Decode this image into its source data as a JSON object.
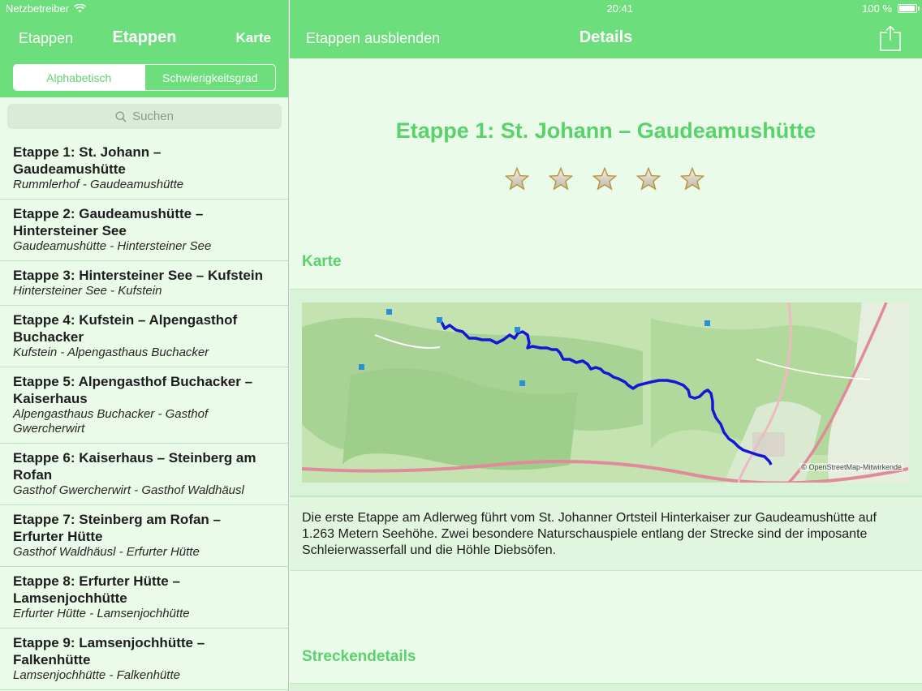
{
  "status_bar": {
    "carrier": "Netzbetreiber",
    "time": "20:41",
    "battery": "100 %"
  },
  "left_nav": {
    "back_label": "Etappen",
    "title": "Etappen",
    "map_label": "Karte"
  },
  "segmented_control": {
    "options": [
      "Alphabetisch",
      "Schwierigkeitsgrad"
    ],
    "selected": "Alphabetisch"
  },
  "search": {
    "placeholder": "Suchen"
  },
  "stages": [
    {
      "title": "Etappe 1: St. Johann – Gaudeamushütte",
      "subtitle": "Rummlerhof - Gaudeamushütte"
    },
    {
      "title": "Etappe 2: Gaudeamushütte – Hintersteiner See",
      "subtitle": "Gaudeamushütte - Hintersteiner See"
    },
    {
      "title": "Etappe 3: Hintersteiner See – Kufstein",
      "subtitle": "Hintersteiner See - Kufstein"
    },
    {
      "title": "Etappe 4: Kufstein –  Alpengasthof Buchacker",
      "subtitle": "Kufstein - Alpengasthaus Buchacker"
    },
    {
      "title": "Etappe 5: Alpengasthof Buchacker – Kaiserhaus",
      "subtitle": "Alpengasthaus Buchacker - Gasthof Gwercherwirt"
    },
    {
      "title": "Etappe 6: Kaiserhaus – Steinberg am Rofan",
      "subtitle": "Gasthof Gwercherwirt - Gasthof Waldhäusl"
    },
    {
      "title": "Etappe 7: Steinberg am Rofan – Erfurter Hütte",
      "subtitle": "Gasthof Waldhäusl - Erfurter Hütte"
    },
    {
      "title": "Etappe 8: Erfurter Hütte – Lamsenjochhütte",
      "subtitle": "Erfurter Hütte - Lamsenjochhütte"
    },
    {
      "title": "Etappe 9: Lamsenjochhütte – Falkenhütte",
      "subtitle": "Lamsenjochhütte - Falkenhütte"
    }
  ],
  "right_nav": {
    "hide_label": "Etappen ausblenden",
    "title": "Details",
    "share_icon": "share-icon"
  },
  "detail": {
    "title": "Etappe 1: St. Johann – Gaudeamushütte",
    "difficulty_stars": 5,
    "map_section_label": "Karte",
    "map_attribution": "© OpenStreetMap-Mitwirkende",
    "description": "Die erste Etappe am Adlerweg führt vom St. Johanner Ortsteil Hinterkaiser zur Gaudeamushütte auf 1.263 Metern Seehöhe. Zwei besondere Naturschauspiele entlang der Strecke sind der imposante Schleierwasserfall und die Höhle Diebsöfen.",
    "route_details_label": "Streckendetails"
  },
  "colors": {
    "accent": "#6cde7c",
    "accent_text": "#5ad26b",
    "route": "#1616d8"
  }
}
